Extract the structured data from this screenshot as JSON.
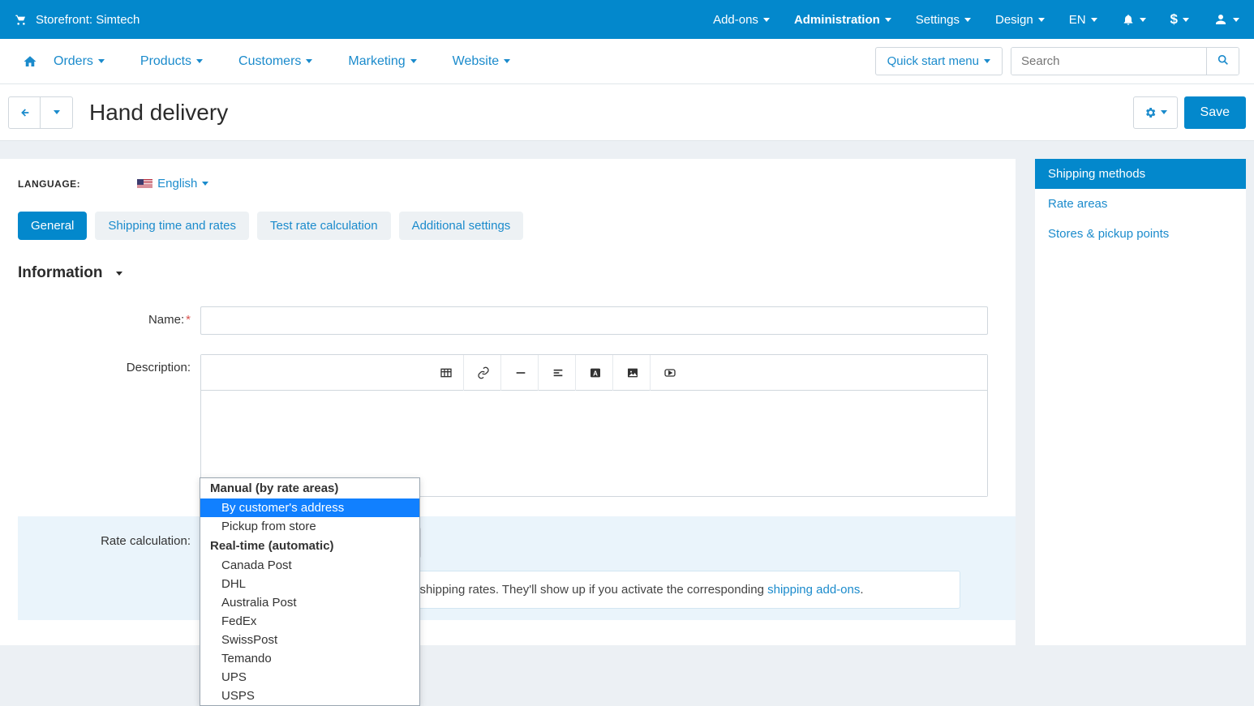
{
  "topbar": {
    "storefront_label": "Storefront: Simtech",
    "menu": {
      "addons": "Add-ons",
      "administration": "Administration",
      "settings": "Settings",
      "design": "Design",
      "lang": "EN",
      "currency": "$"
    }
  },
  "navbar": {
    "orders": "Orders",
    "products": "Products",
    "customers": "Customers",
    "marketing": "Marketing",
    "website": "Website",
    "quickstart": "Quick start menu",
    "search_placeholder": "Search"
  },
  "title": {
    "page_title": "Hand delivery",
    "save": "Save"
  },
  "language_row": {
    "label": "LANGUAGE:",
    "value": "English"
  },
  "tabs": {
    "general": "General",
    "shipping": "Shipping time and rates",
    "test": "Test rate calculation",
    "additional": "Additional settings"
  },
  "section": {
    "information": "Information"
  },
  "fields": {
    "name_label": "Name:",
    "description_label": "Description:",
    "rate_label": "Rate calculation:",
    "rate_value": "By customer's address"
  },
  "dropdown": {
    "group_manual": "Manual (by rate areas)",
    "group_realtime": "Real-time (automatic)",
    "opts_manual": [
      "By customer's address",
      "Pickup from store"
    ],
    "opts_realtime": [
      "Canada Post",
      "DHL",
      "Australia Post",
      "FedEx",
      "SwissPost",
      "Temando",
      "UPS",
      "USPS"
    ],
    "selected": "By customer's address"
  },
  "infobox": {
    "text_pre": "There may be more ways to calculate shipping rates. They'll show up if you activate the corresponding ",
    "link": "shipping add-ons",
    "text_post": "."
  },
  "sidebar": {
    "items": [
      {
        "label": "Shipping methods",
        "active": true
      },
      {
        "label": "Rate areas",
        "active": false
      },
      {
        "label": "Stores & pickup points",
        "active": false
      }
    ]
  }
}
